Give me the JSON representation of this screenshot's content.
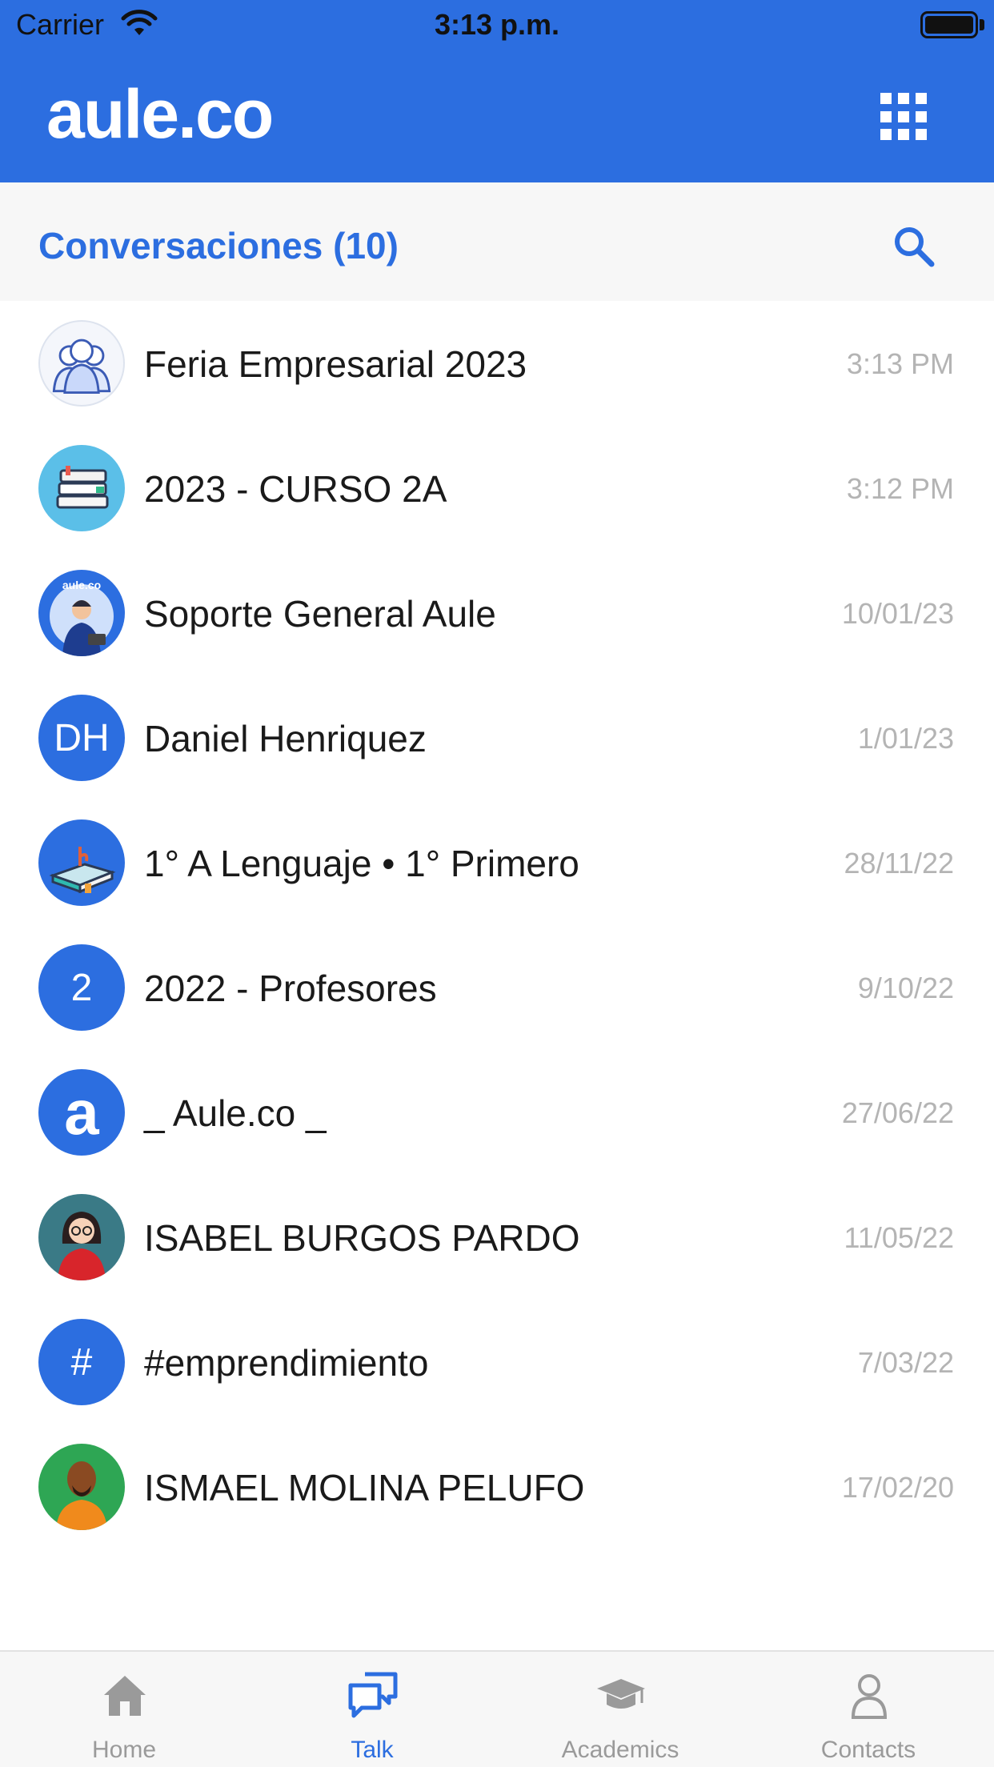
{
  "status_bar": {
    "carrier": "Carrier",
    "time": "3:13 p.m."
  },
  "header": {
    "logo": "aule.co",
    "apps_icon": "grid-icon"
  },
  "conversations": {
    "title": "Conversaciones (10)",
    "search_icon": "search-icon",
    "items": [
      {
        "name": "Feria Empresarial 2023",
        "time": "3:13 PM",
        "avatar": "group-illustration"
      },
      {
        "name": "2023 - CURSO 2A",
        "time": "3:12 PM",
        "avatar": "books-illustration"
      },
      {
        "name": "Soporte General Aule",
        "time": "10/01/23",
        "avatar": "support-agent-illustration"
      },
      {
        "name": "Daniel Henriquez",
        "time": "1/01/23",
        "avatar_text": "DH"
      },
      {
        "name": "1° A Lenguaje • 1° Primero",
        "time": "28/11/22",
        "avatar": "book-illustration"
      },
      {
        "name": "2022 - Profesores",
        "time": "9/10/22",
        "avatar_text": "2"
      },
      {
        "name": "_ Aule.co _",
        "time": "27/06/22",
        "avatar_text": "a"
      },
      {
        "name": "ISABEL BURGOS PARDO",
        "time": "11/05/22",
        "avatar": "woman-illustration"
      },
      {
        "name": "#emprendimiento",
        "time": "7/03/22",
        "avatar_text": "#"
      },
      {
        "name": "ISMAEL MOLINA PELUFO",
        "time": "17/02/20",
        "avatar": "man-illustration"
      }
    ]
  },
  "tabbar": {
    "active": "Talk",
    "tabs": [
      {
        "label": "Home",
        "icon": "home-icon"
      },
      {
        "label": "Talk",
        "icon": "chat-icon"
      },
      {
        "label": "Academics",
        "icon": "graduation-cap-icon"
      },
      {
        "label": "Contacts",
        "icon": "person-icon"
      }
    ]
  },
  "colors": {
    "brand": "#2c6ee0",
    "time_gray": "#b4b4b4",
    "tab_inactive": "#9a9a9a"
  }
}
